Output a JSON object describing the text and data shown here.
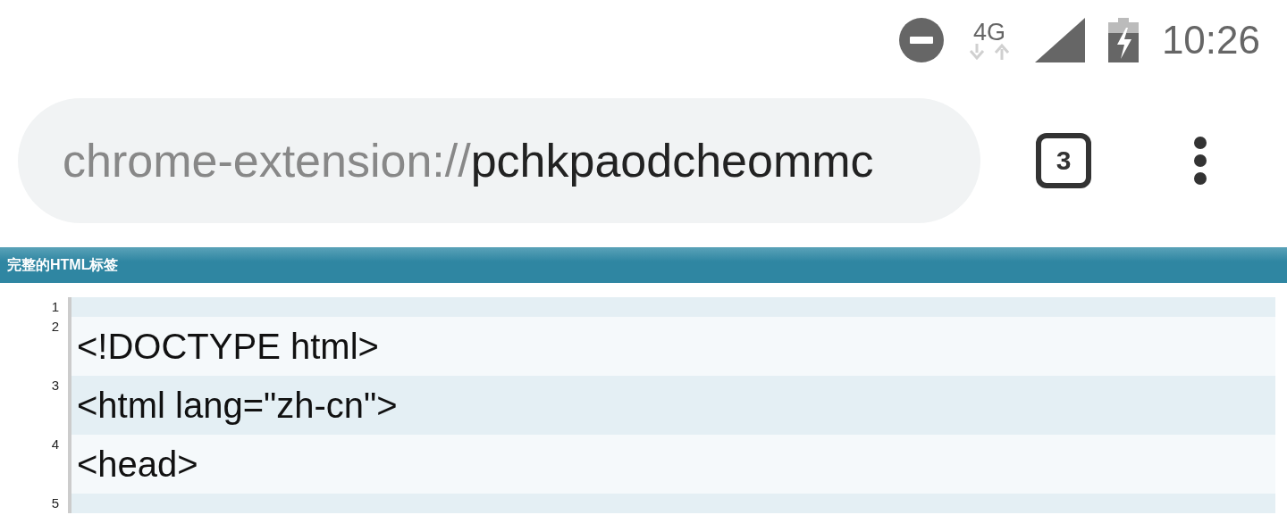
{
  "status_bar": {
    "network": "4G",
    "time": "10:26"
  },
  "address_bar": {
    "scheme": "chrome-extension://",
    "host": "pchkpaodcheommc",
    "tab_count": "3"
  },
  "panel": {
    "title": "完整的HTML标签",
    "lines": [
      {
        "number": "1"
      },
      {
        "number": "2",
        "text": "<!DOCTYPE html>"
      },
      {
        "number": "3",
        "text": "<html lang=\"zh-cn\">"
      },
      {
        "number": "4",
        "text": "<head>"
      },
      {
        "number": "5"
      }
    ]
  }
}
